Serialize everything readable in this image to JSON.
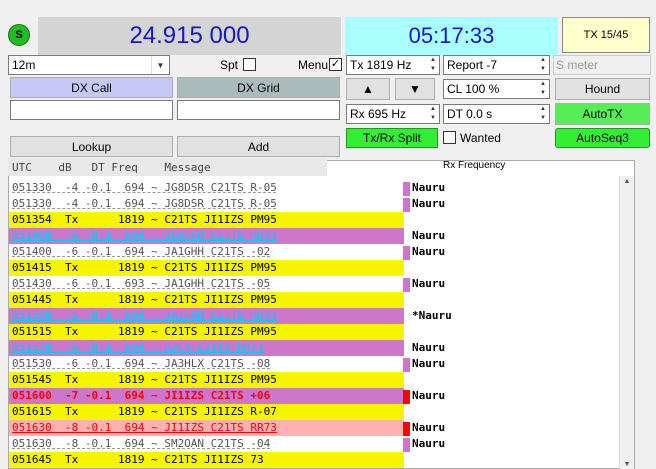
{
  "status_icon": {
    "label": "S",
    "color": "#22bb22"
  },
  "dial_frequency": "24.915 000",
  "utc_clock": "05:17:33",
  "tx_button": "TX 15/45",
  "band": "12m",
  "spot_label": "Spt",
  "spot_checked": false,
  "menu_label": "Menu",
  "menu_checked": true,
  "dx_call_label": "DX Call",
  "dx_grid_label": "DX Grid",
  "lookup_label": "Lookup",
  "add_label": "Add",
  "tx_freq": "Tx  1819  Hz",
  "rx_freq": "Rx  695  Hz",
  "report": "Report -7",
  "cl": "CL  100 %",
  "dt": "DT 0.0 s",
  "s_meter": "S meter",
  "hound_label": "Hound",
  "autotx_label": "AutoTX",
  "autoseq_label": "AutoSeq3",
  "split_label": "Tx/Rx Split",
  "wanted_label": "Wanted",
  "decode_header": "UTC    dB   DT Freq    Message",
  "rx_frequency_label": "Rx Frequency",
  "colors": {
    "yellow": "#f5f500",
    "magenta": "#cc77cc",
    "cyan_text": "#00ccff",
    "red": "#ff0000",
    "green_btn": "#55ee55"
  },
  "rows": [
    {
      "text": "051330  -4 -0.1  694 ~ JG8DSR C21TS R-05",
      "label": "Nauru",
      "style": "plain",
      "bar": "#cc77cc"
    },
    {
      "text": "051330  -4 -0.1  694 ~ JG8DSR C21TS R-05",
      "label": "Nauru",
      "style": "plain",
      "bar": "#cc77cc"
    },
    {
      "text": "051354  Tx      1819 ~ C21TS JI1IZS PM95",
      "label": "",
      "style": "tx",
      "bar": ""
    },
    {
      "text": "051400  -6 -0.1  694 ~ JG8DSR C21TS RR73",
      "label": "Nauru",
      "style": "rr73",
      "bar": ""
    },
    {
      "text": "051400  -6 -0.1  694 ~ JA1GHH C21TS -02",
      "label": "Nauru",
      "style": "plain",
      "bar": "#cc77cc"
    },
    {
      "text": "051415  Tx      1819 ~ C21TS JI1IZS PM95",
      "label": "",
      "style": "tx",
      "bar": ""
    },
    {
      "text": "051430  -6 -0.1  693 ~ JA1GHH C21TS -05",
      "label": "Nauru",
      "style": "plain",
      "bar": "#cc77cc"
    },
    {
      "text": "051445  Tx      1819 ~ C21TS JI1IZS PM95",
      "label": "",
      "style": "tx",
      "bar": ""
    },
    {
      "text": "051500  -5 -0.1  694 ~ JA1GHH C21TS RR73",
      "label": "*Nauru",
      "style": "rr73",
      "bar": ""
    },
    {
      "text": "051515  Tx      1819 ~ C21TS JI1IZS PM95",
      "label": "",
      "style": "tx",
      "bar": ""
    },
    {
      "text": "051530  -6 -0.1  694 ~ R3CR C21TS RR73",
      "label": "Nauru",
      "style": "rr73",
      "bar": ""
    },
    {
      "text": "051530  -6 -0.1  694 ~ JA3HLX C21TS -08",
      "label": "Nauru",
      "style": "plain",
      "bar": "#cc77cc"
    },
    {
      "text": "051545  Tx      1819 ~ C21TS JI1IZS PM95",
      "label": "",
      "style": "tx",
      "bar": ""
    },
    {
      "text": "051600  -7 -0.1  694 ~ JI1IZS C21TS +06",
      "label": "Nauru",
      "style": "me",
      "bar": "#ff0000"
    },
    {
      "text": "051615  Tx      1819 ~ C21TS JI1IZS R-07",
      "label": "",
      "style": "tx",
      "bar": ""
    },
    {
      "text": "051630  -8 -0.1  694 ~ JI1IZS C21TS RR73",
      "label": "Nauru",
      "style": "me_pink",
      "bar": "#ff0000"
    },
    {
      "text": "051630  -8 -0.1  694 ~ SM2OAN C21TS -04",
      "label": "Nauru",
      "style": "plain",
      "bar": "#cc77cc"
    },
    {
      "text": "051645  Tx      1819 ~ C21TS JI1IZS 73",
      "label": "",
      "style": "tx",
      "bar": ""
    }
  ]
}
